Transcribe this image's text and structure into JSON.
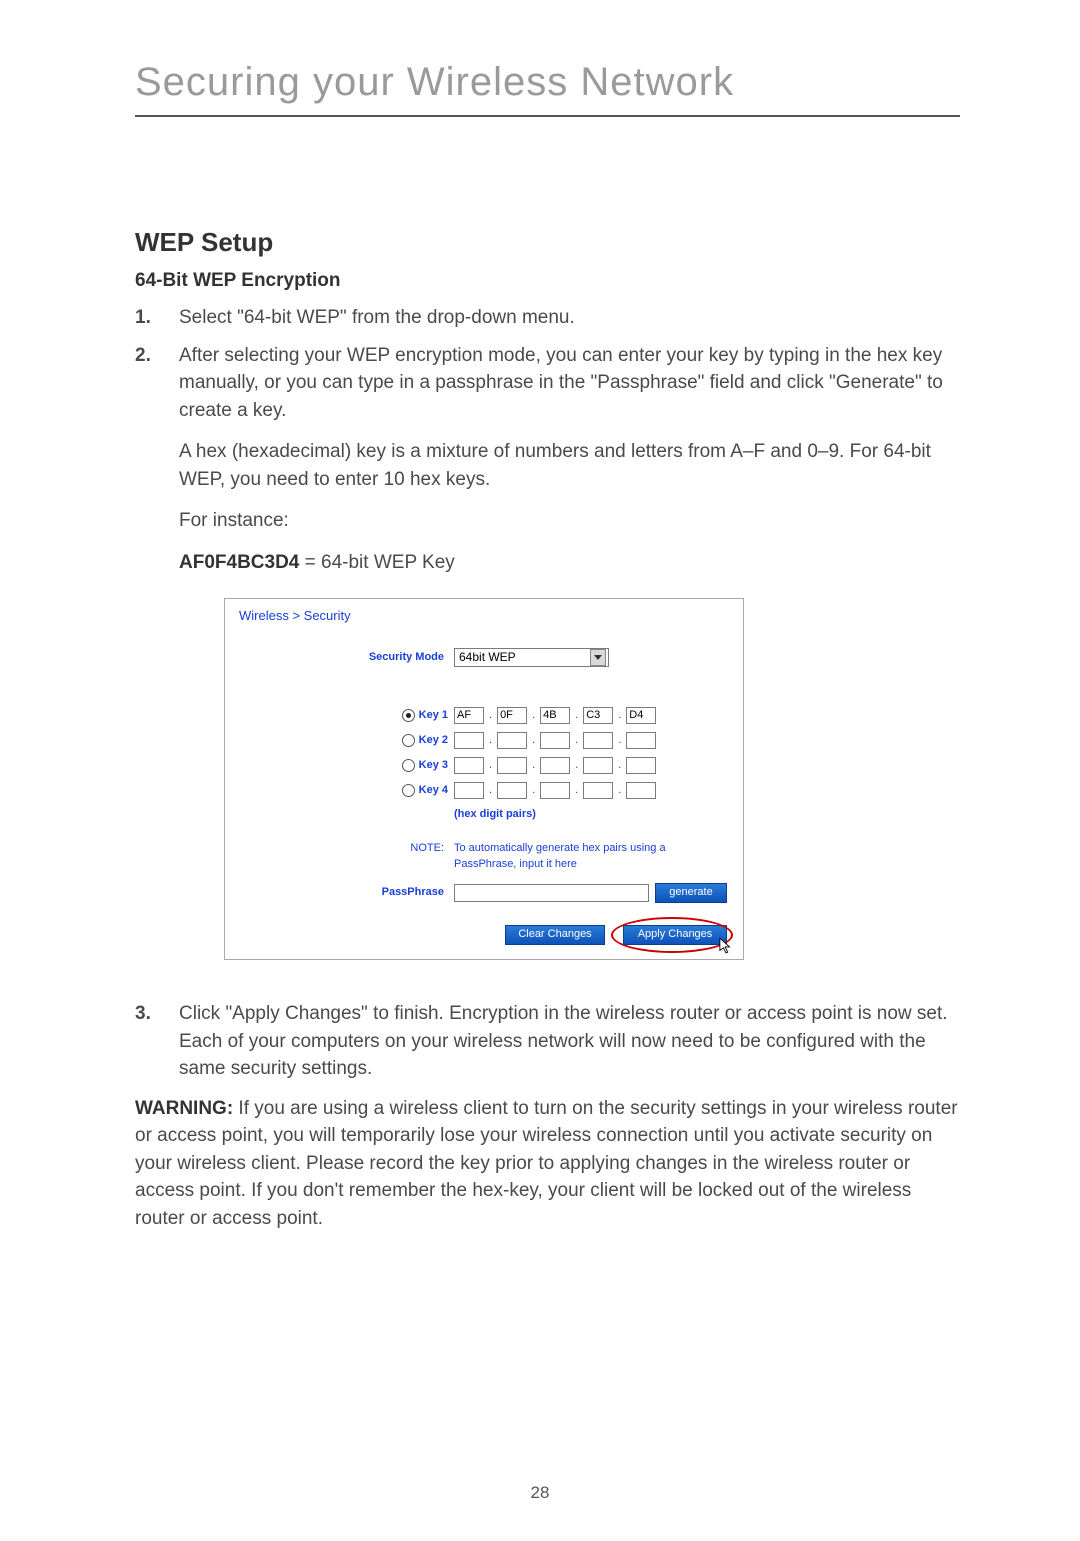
{
  "page_title": "Securing your Wireless Network",
  "section_heading": "WEP Setup",
  "sub_heading": "64-Bit WEP Encryption",
  "steps": {
    "s1_num": "1.",
    "s1_text": "Select \"64-bit WEP\" from the drop-down menu.",
    "s2_num": "2.",
    "s2_text": "After selecting your WEP encryption mode, you can enter your key by typing in the hex key manually, or you can type in a passphrase in the \"Passphrase\" field and click \"Generate\" to create a key.",
    "s2_para2": "A hex (hexadecimal) key is a mixture of numbers and letters from A–F and 0–9. For 64-bit WEP, you need to enter 10 hex keys.",
    "s2_para3": "For instance:",
    "s2_wep_key_code": "AF0F4BC3D4",
    "s2_wep_key_desc": " = 64-bit WEP Key",
    "s3_num": "3.",
    "s3_text": "Click \"Apply Changes\" to finish. Encryption in the wireless router or access point is now set. Each of your computers on your wireless network will now need to be configured with the same security settings."
  },
  "warning_label": "WARNING:",
  "warning_text": " If you are using a wireless client to turn on the security settings in your wireless router or access point, you will temporarily lose your wireless connection until you activate security on your wireless client. Please record the key prior to applying changes in the wireless router or access point. If you don't remember the hex-key, your client will be locked out of the wireless router or access point.",
  "page_number": "28",
  "panel": {
    "breadcrumb": "Wireless > Security",
    "security_mode_label": "Security Mode",
    "security_mode_value": "64bit WEP",
    "keys": {
      "k1_label": "Key 1",
      "k2_label": "Key 2",
      "k3_label": "Key 3",
      "k4_label": "Key 4",
      "k1_v1": "AF",
      "k1_v2": "0F",
      "k1_v3": "4B",
      "k1_v4": "C3",
      "k1_v5": "D4"
    },
    "hex_note": "(hex digit pairs)",
    "note_label": "NOTE:",
    "note_text": "To automatically generate hex pairs using a PassPhrase, input it here",
    "passphrase_label": "PassPhrase",
    "generate_btn": "generate",
    "clear_btn": "Clear Changes",
    "apply_btn": "Apply Changes"
  }
}
